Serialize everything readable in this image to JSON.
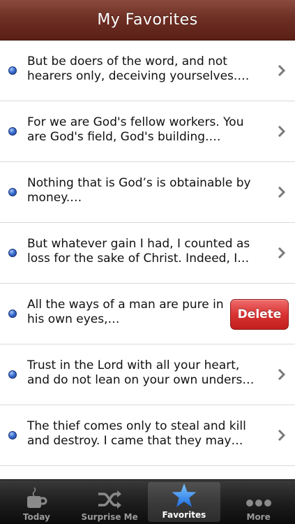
{
  "navbar": {
    "title": "My Favorites"
  },
  "favorites": [
    {
      "text": "But be doers of the word, and not hearers only, deceiving yourselves.…"
    },
    {
      "text": "For we are God's fellow workers. You are God's field, God's building.…"
    },
    {
      "text": "Nothing that is God’s is obtainable by money.…"
    },
    {
      "text": "But whatever gain I had, I counted as loss for the sake of Christ. Indeed, I…"
    },
    {
      "text": "All the ways of a man are pure in his own eyes,…",
      "delete_label": "Delete"
    },
    {
      "text": "Trust in the Lord with all your heart, and do not lean on your own unders…"
    },
    {
      "text": " The thief comes only to steal and kill and destroy. I came that they may…"
    }
  ],
  "tabbar": {
    "tabs": [
      {
        "label": "Today",
        "icon": "coffee-cup-icon"
      },
      {
        "label": "Surprise Me",
        "icon": "shuffle-icon"
      },
      {
        "label": "Favorites",
        "icon": "star-icon",
        "active": true
      },
      {
        "label": "More",
        "icon": "more-dots-icon"
      }
    ]
  },
  "colors": {
    "navbar": "#6e2f24",
    "delete": "#d93434",
    "bullet": "#3b6fd1",
    "star": "#3a8ef0"
  }
}
